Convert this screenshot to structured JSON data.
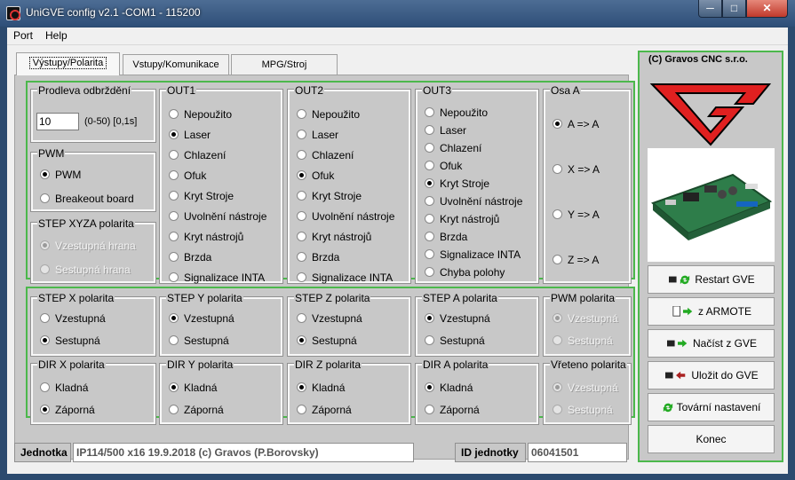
{
  "window": {
    "title": "UniGVE config v2.1 -COM1 - 115200"
  },
  "menu": {
    "port": "Port",
    "help": "Help"
  },
  "tabs": [
    "Výstupy/Polarita",
    "Vstupy/Komunikace",
    "MPG/Stroj"
  ],
  "delay": {
    "title": "Prodleva odbrždění",
    "value": "10",
    "unit": "(0-50) [0,1s]"
  },
  "pwm": {
    "title": "PWM",
    "options": [
      {
        "label": "PWM",
        "checked": true
      },
      {
        "label": "Breakeout board",
        "checked": false
      }
    ]
  },
  "step_xyza": {
    "title": "STEP XYZA polarita",
    "options": [
      {
        "label": "Vzestupná hrana",
        "checked": true
      },
      {
        "label": "Sestupná hrana",
        "checked": false
      }
    ]
  },
  "outputs": [
    {
      "title": "OUT1",
      "options": [
        "Nepoužito",
        "Laser",
        "Chlazení",
        "Ofuk",
        "Kryt Stroje",
        "Uvolnění nástroje",
        "Kryt nástrojů",
        "Brzda",
        "Signalizace INTA"
      ],
      "checked": 1
    },
    {
      "title": "OUT2",
      "options": [
        "Nepoužito",
        "Laser",
        "Chlazení",
        "Ofuk",
        "Kryt Stroje",
        "Uvolnění nástroje",
        "Kryt nástrojů",
        "Brzda",
        "Signalizace INTA"
      ],
      "checked": 3
    },
    {
      "title": "OUT3",
      "options": [
        "Nepoužito",
        "Laser",
        "Chlazení",
        "Ofuk",
        "Kryt Stroje",
        "Uvolnění nástroje",
        "Kryt nástrojů",
        "Brzda",
        "Signalizace INTA",
        "Chyba polohy"
      ],
      "checked": 4
    }
  ],
  "osa": {
    "title": "Osa A",
    "options": [
      "A => A",
      "X => A",
      "Y => A",
      "Z => A"
    ],
    "checked": 0
  },
  "step_pol": [
    {
      "title": "STEP X polarita",
      "options": [
        "Vzestupná",
        "Sestupná"
      ],
      "checked": 1
    },
    {
      "title": "STEP Y polarita",
      "options": [
        "Vzestupná",
        "Sestupná"
      ],
      "checked": 0
    },
    {
      "title": "STEP Z polarita",
      "options": [
        "Vzestupná",
        "Sestupná"
      ],
      "checked": 1
    },
    {
      "title": "STEP A polarita",
      "options": [
        "Vzestupná",
        "Sestupná"
      ],
      "checked": 0
    }
  ],
  "pwm_pol": {
    "title": "PWM polarita",
    "options": [
      "Vzestupná",
      "Sestupná"
    ],
    "checked": 0
  },
  "dir_pol": [
    {
      "title": "DIR X polarita",
      "options": [
        "Kladná",
        "Záporná"
      ],
      "checked": 1
    },
    {
      "title": "DIR Y polarita",
      "options": [
        "Kladná",
        "Záporná"
      ],
      "checked": 0
    },
    {
      "title": "DIR Z polarita",
      "options": [
        "Kladná",
        "Záporná"
      ],
      "checked": 0
    },
    {
      "title": "DIR A polarita",
      "options": [
        "Kladná",
        "Záporná"
      ],
      "checked": 0
    }
  ],
  "vreteno_pol": {
    "title": "Vřeteno polarita",
    "options": [
      "Vzestupná",
      "Sestupná"
    ],
    "checked": 0
  },
  "right": {
    "brand": "(C) Gravos CNC s.r.o.",
    "buttons": [
      {
        "label": "Restart GVE"
      },
      {
        "label": "z ARMOTE"
      },
      {
        "label": "Načíst z GVE"
      },
      {
        "label": "Uložit do GVE"
      },
      {
        "label": "Tovární nastavení"
      },
      {
        "label": "Konec"
      }
    ]
  },
  "status": {
    "unit_label": "Jednotka",
    "unit_value": "IP114/500 x16 19.9.2018 (c) Gravos (P.Borovsky)",
    "id_label": "ID jednotky",
    "id_value": "06041501"
  },
  "colors": {
    "accent_green": "#4cb84c",
    "logo_red": "#e02020",
    "title_bar": "#3a5a80"
  }
}
